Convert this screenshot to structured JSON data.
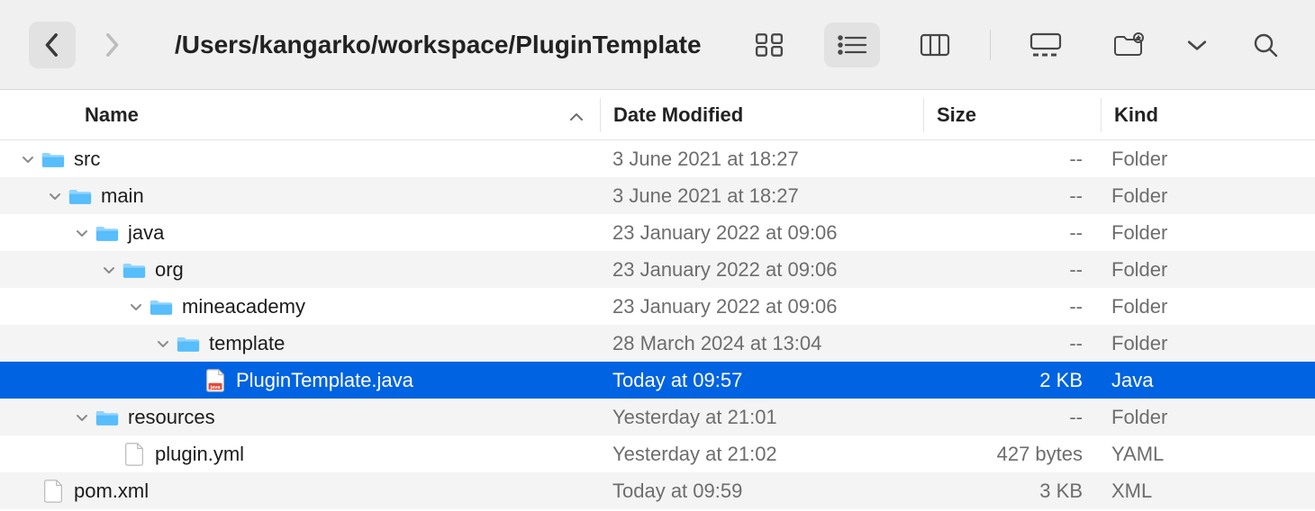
{
  "path": "/Users/kangarko/workspace/PluginTemplate",
  "columns": {
    "name": "Name",
    "date": "Date Modified",
    "size": "Size",
    "kind": "Kind"
  },
  "rows": [
    {
      "depth": 0,
      "chev": true,
      "icon": "folder",
      "name": "src",
      "date": "3 June 2021 at 18:27",
      "size": "--",
      "kind": "Folder",
      "alt": false,
      "sel": false
    },
    {
      "depth": 1,
      "chev": true,
      "icon": "folder",
      "name": "main",
      "date": "3 June 2021 at 18:27",
      "size": "--",
      "kind": "Folder",
      "alt": true,
      "sel": false
    },
    {
      "depth": 2,
      "chev": true,
      "icon": "folder",
      "name": "java",
      "date": "23 January 2022 at 09:06",
      "size": "--",
      "kind": "Folder",
      "alt": false,
      "sel": false
    },
    {
      "depth": 3,
      "chev": true,
      "icon": "folder",
      "name": "org",
      "date": "23 January 2022 at 09:06",
      "size": "--",
      "kind": "Folder",
      "alt": true,
      "sel": false
    },
    {
      "depth": 4,
      "chev": true,
      "icon": "folder",
      "name": "mineacademy",
      "date": "23 January 2022 at 09:06",
      "size": "--",
      "kind": "Folder",
      "alt": false,
      "sel": false
    },
    {
      "depth": 5,
      "chev": true,
      "icon": "folder",
      "name": "template",
      "date": "28 March 2024 at 13:04",
      "size": "--",
      "kind": "Folder",
      "alt": true,
      "sel": false
    },
    {
      "depth": 6,
      "chev": false,
      "icon": "java",
      "name": "PluginTemplate.java",
      "date": "Today at 09:57",
      "size": "2 KB",
      "kind": "Java",
      "alt": false,
      "sel": true
    },
    {
      "depth": 2,
      "chev": true,
      "icon": "folder",
      "name": "resources",
      "date": "Yesterday at 21:01",
      "size": "--",
      "kind": "Folder",
      "alt": true,
      "sel": false
    },
    {
      "depth": 3,
      "chev": false,
      "icon": "file",
      "name": "plugin.yml",
      "date": "Yesterday at 21:02",
      "size": "427 bytes",
      "kind": "YAML",
      "alt": false,
      "sel": false
    },
    {
      "depth": 0,
      "chev": false,
      "icon": "file",
      "name": "pom.xml",
      "date": "Today at 09:59",
      "size": "3 KB",
      "kind": "XML",
      "alt": true,
      "sel": false
    }
  ]
}
